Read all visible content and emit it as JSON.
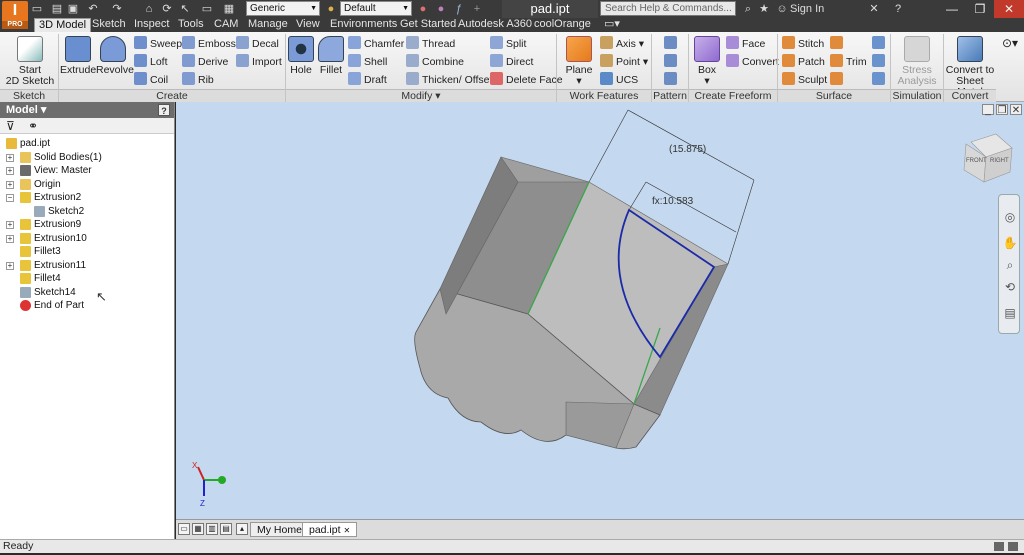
{
  "app": {
    "logo": "I",
    "edition": "PRO",
    "document_title": "pad.ipt"
  },
  "title_bar": {
    "material_combo": "Generic",
    "appearance_combo": "Default",
    "search_placeholder": "Search Help & Commands...",
    "sign_in": "Sign In"
  },
  "tabs": [
    "3D Model",
    "Sketch",
    "Inspect",
    "Tools",
    "CAM",
    "Manage",
    "View",
    "Environments",
    "Get Started",
    "Autodesk A360",
    "coolOrange"
  ],
  "active_tab": "3D Model",
  "ribbon": {
    "sketch": {
      "start_line1": "Start",
      "start_line2": "2D Sketch",
      "panel": "Sketch"
    },
    "create": {
      "extrude": "Extrude",
      "revolve": "Revolve",
      "sweep": "Sweep",
      "loft": "Loft",
      "coil": "Coil",
      "emboss": "Emboss",
      "derive": "Derive",
      "rib": "Rib",
      "decal": "Decal",
      "import": "Import",
      "panel": "Create"
    },
    "modify": {
      "hole": "Hole",
      "fillet": "Fillet",
      "chamfer": "Chamfer",
      "shell": "Shell",
      "draft": "Draft",
      "thread": "Thread",
      "combine": "Combine",
      "thicken": "Thicken/ Offset",
      "split": "Split",
      "direct": "Direct",
      "delete_face": "Delete Face",
      "panel": "Modify"
    },
    "work_features": {
      "plane": "Plane",
      "axis": "Axis",
      "point": "Point",
      "ucs": "UCS",
      "panel": "Work Features"
    },
    "pattern": {
      "panel": "Pattern"
    },
    "freeform": {
      "box": "Box",
      "face": "Face",
      "convert": "Convert",
      "panel": "Create Freeform"
    },
    "surface": {
      "stitch": "Stitch",
      "patch": "Patch",
      "sculpt": "Sculpt",
      "trim": "Trim",
      "panel": "Surface"
    },
    "simulation": {
      "stress_line1": "Stress",
      "stress_line2": "Analysis",
      "panel": "Simulation"
    },
    "convert": {
      "line1": "Convert to",
      "line2": "Sheet Metal",
      "panel": "Convert"
    }
  },
  "browser": {
    "title": "Model",
    "help": "?",
    "tree": [
      {
        "label": "pad.ipt",
        "level": 0,
        "expander": "",
        "icon": "part"
      },
      {
        "label": "Solid Bodies(1)",
        "level": 1,
        "expander": "+",
        "icon": "folder"
      },
      {
        "label": "View: Master",
        "level": 1,
        "expander": "+",
        "icon": "view"
      },
      {
        "label": "Origin",
        "level": 1,
        "expander": "+",
        "icon": "folder"
      },
      {
        "label": "Extrusion2",
        "level": 1,
        "expander": "−",
        "icon": "extrusion"
      },
      {
        "label": "Sketch2",
        "level": 2,
        "expander": "",
        "icon": "sketch"
      },
      {
        "label": "Extrusion9",
        "level": 1,
        "expander": "+",
        "icon": "extrusion"
      },
      {
        "label": "Extrusion10",
        "level": 1,
        "expander": "+",
        "icon": "extrusion"
      },
      {
        "label": "Fillet3",
        "level": 1,
        "expander": "",
        "icon": "fillet"
      },
      {
        "label": "Extrusion11",
        "level": 1,
        "expander": "+",
        "icon": "extrusion"
      },
      {
        "label": "Fillet4",
        "level": 1,
        "expander": "",
        "icon": "fillet"
      },
      {
        "label": "Sketch14",
        "level": 1,
        "expander": "",
        "icon": "sketch"
      },
      {
        "label": "End of Part",
        "level": 1,
        "expander": "",
        "icon": "end"
      }
    ]
  },
  "viewport": {
    "dimension_outer": "(15.875)",
    "dimension_inner": "fx:10.583",
    "viewcube_front": "FRONT",
    "viewcube_right": "RIGHT"
  },
  "document_tabs": [
    "My Home",
    "pad.ipt"
  ],
  "active_document_tab": "pad.ipt",
  "status": "Ready"
}
